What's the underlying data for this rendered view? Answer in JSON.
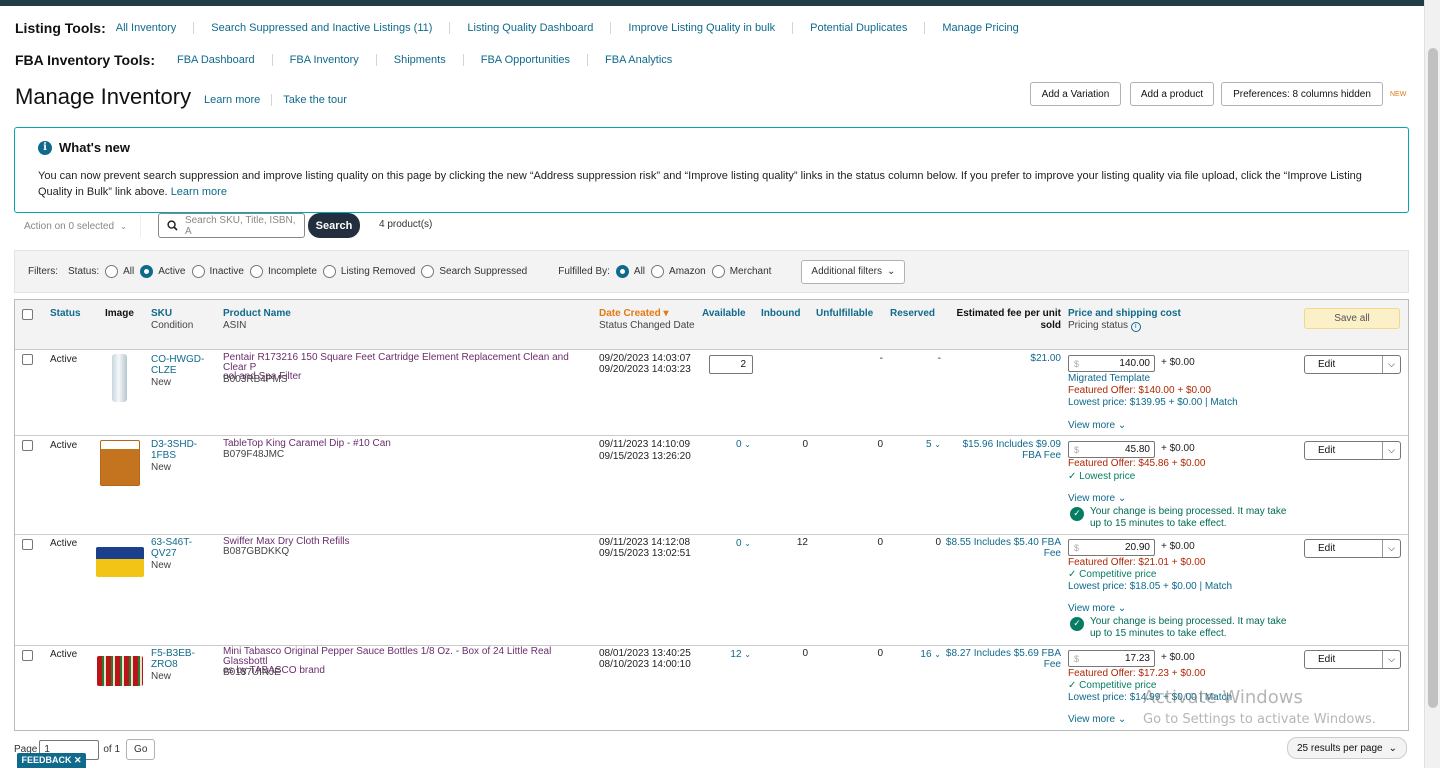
{
  "listing_tools": {
    "title": "Listing Tools:",
    "links": [
      "All Inventory",
      "Search Suppressed and Inactive Listings (11)",
      "Listing Quality Dashboard",
      "Improve Listing Quality in bulk",
      "Potential Duplicates",
      "Manage Pricing"
    ]
  },
  "fba_tools": {
    "title": "FBA Inventory Tools:",
    "links": [
      "FBA Dashboard",
      "FBA Inventory",
      "Shipments",
      "FBA Opportunities",
      "FBA Analytics"
    ]
  },
  "page": {
    "title": "Manage Inventory",
    "learn_more": "Learn more",
    "take_tour": "Take the tour",
    "add_variation": "Add a Variation",
    "add_product": "Add a product",
    "preferences": "Preferences: 8 columns hidden",
    "new_badge": "NEW"
  },
  "whats_new": {
    "title": "What's new",
    "body": "You can now prevent search suppression and improve listing quality on this page by clicking the new “Address suppression risk” and “Improve listing quality” links in the status column below. If you prefer to improve your listing quality via file upload, click the “Improve Listing Quality in Bulk” link above.",
    "link": "Learn more"
  },
  "toolbar": {
    "action": "Action on 0 selected",
    "search_placeholder": "Search SKU, Title, ISBN, A",
    "search_button": "Search",
    "count": "4 product(s)"
  },
  "filters": {
    "label": "Filters:",
    "status_label": "Status:",
    "status_options": [
      "All",
      "Active",
      "Inactive",
      "Incomplete",
      "Listing Removed",
      "Search Suppressed"
    ],
    "status_selected": "Active",
    "fulfilled_label": "Fulfilled By:",
    "fulfilled_options": [
      "All",
      "Amazon",
      "Merchant"
    ],
    "fulfilled_selected": "All",
    "additional": "Additional filters"
  },
  "table": {
    "headers": {
      "status": "Status",
      "image": "Image",
      "sku": "SKU",
      "condition": "Condition",
      "product_name": "Product Name",
      "asin": "ASIN",
      "date_created": "Date Created",
      "status_changed": "Status Changed Date",
      "available": "Available",
      "inbound": "Inbound",
      "unfulfillable": "Unfulfillable",
      "reserved": "Reserved",
      "fee_line1": "Estimated fee per unit",
      "fee_line2": "sold",
      "price": "Price and shipping cost",
      "pricing_status": "Pricing status",
      "save_all": "Save all"
    },
    "rows": [
      {
        "status": "Active",
        "sku1": "CO-HWGD-",
        "sku2": "CLZE",
        "condition": "New",
        "name1": "Pentair R173216 150 Square Feet Cartridge Element Replacement Clean and Clear P",
        "name2": "ool and Spa Filter",
        "asin": "B003RB4PMS",
        "created": "09/20/2023 14:03:07",
        "changed": "09/20/2023 14:03:23",
        "available": "2",
        "inbound": "",
        "unfulfillable": "-",
        "reserved": "-",
        "fee": "$21.00",
        "fee2": "",
        "price": "140.00",
        "ship": "+ $0.00",
        "info": [
          "Migrated Template",
          "Featured Offer: $140.00 + $0.00",
          "Lowest price: $139.95 + $0.00 | Match"
        ],
        "view_more": "View more",
        "msg": "",
        "edit": "Edit"
      },
      {
        "status": "Active",
        "sku1": "D3-3SHD-",
        "sku2": "1FBS",
        "condition": "New",
        "name1": "TableTop King Caramel Dip - #10 Can",
        "name2": "",
        "asin": "B079F48JMC",
        "created": "09/11/2023 14:10:09",
        "changed": "09/15/2023 13:26:20",
        "available": "0",
        "inbound": "0",
        "unfulfillable": "0",
        "reserved": "5",
        "fee": "$15.96 Includes $9.09",
        "fee2": "FBA Fee",
        "price": "45.80",
        "ship": "+ $0.00",
        "info": [
          "Featured Offer: $45.86 + $0.00",
          "✓ Lowest price"
        ],
        "view_more": "View more",
        "msg": "Your change is being processed. It may take up to 15 minutes to take effect.",
        "edit": "Edit"
      },
      {
        "status": "Active",
        "sku1": "63-S46T-",
        "sku2": "QV27",
        "condition": "New",
        "name1": "Swiffer Max Dry Cloth Refills",
        "name2": "",
        "asin": "B087GBDKKQ",
        "created": "09/11/2023 14:12:08",
        "changed": "09/15/2023 13:02:51",
        "available": "0",
        "inbound": "12",
        "unfulfillable": "0",
        "reserved": "0",
        "fee": "$8.55 Includes $5.40 FBA",
        "fee2": "Fee",
        "price": "20.90",
        "ship": "+ $0.00",
        "info": [
          "Featured Offer: $21.01 + $0.00",
          "✓ Competitive price",
          "Lowest price: $18.05 + $0.00 | Match"
        ],
        "view_more": "View more",
        "msg": "Your change is being processed. It may take up to 15 minutes to take effect.",
        "edit": "Edit"
      },
      {
        "status": "Active",
        "sku1": "F5-B3EB-",
        "sku2": "ZRO8",
        "condition": "New",
        "name1": "Mini Tabasco Original Pepper Sauce Bottles 1/8 Oz. - Box of 24 Little Real Glassbottl",
        "name2": "es by TABASCO brand",
        "asin": "B0187UINJE",
        "created": "08/01/2023 13:40:25",
        "changed": "08/10/2023 14:00:10",
        "available": "12",
        "inbound": "0",
        "unfulfillable": "0",
        "reserved": "16",
        "fee": "$8.27 Includes $5.69 FBA",
        "fee2": "Fee",
        "price": "17.23",
        "ship": "+ $0.00",
        "info": [
          "Featured Offer: $17.23 + $0.00",
          "✓ Competitive price",
          "Lowest price: $14.99 + $0.00 | Match"
        ],
        "view_more": "View more",
        "msg": "",
        "edit": "Edit"
      }
    ]
  },
  "footer": {
    "page_label": "Page",
    "page_value": "1",
    "of": "of 1",
    "go": "Go",
    "per_page": "25 results per page",
    "feedback": "FEEDBACK ✕"
  },
  "watermark": {
    "line1": "Activate Windows",
    "line2": "Go to Settings to activate Windows."
  },
  "colors": {
    "accent": "#0f6a8c",
    "sorted": "#e47911",
    "product_link": "#6b2d6d",
    "topbar": "#1f3c47"
  }
}
